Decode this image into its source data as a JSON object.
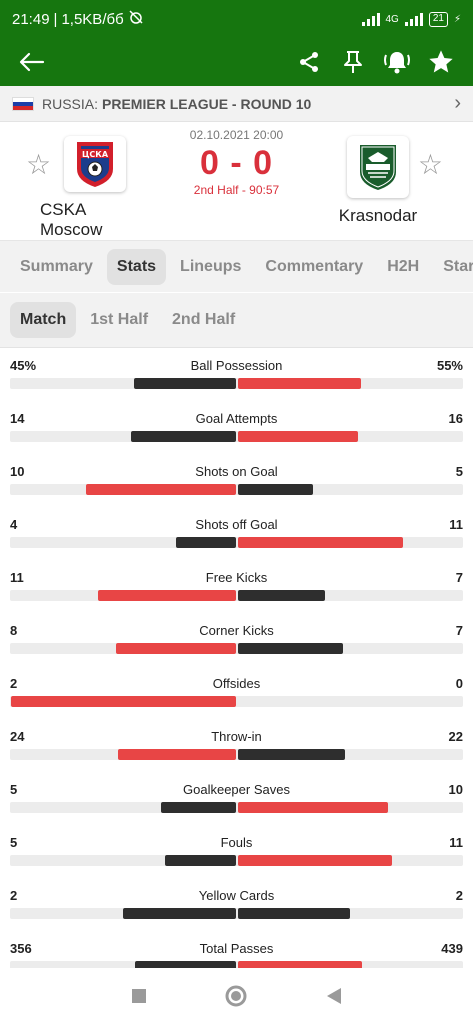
{
  "status_bar": {
    "time": "21:49",
    "speed": "1,5KB/бб",
    "net": "4G",
    "battery": "21"
  },
  "league": {
    "country": "RUSSIA:",
    "name": "PREMIER LEAGUE - ROUND 10"
  },
  "match": {
    "date": "02.10.2021 20:00",
    "score": "0 - 0",
    "status": "2nd Half - 90:57",
    "home": {
      "name": "CSKA Moscow",
      "logo_text": "ЦСКА"
    },
    "away": {
      "name": "Krasnodar"
    }
  },
  "tabs": [
    {
      "label": "Summary",
      "active": false
    },
    {
      "label": "Stats",
      "active": true
    },
    {
      "label": "Lineups",
      "active": false
    },
    {
      "label": "Commentary",
      "active": false
    },
    {
      "label": "H2H",
      "active": false
    },
    {
      "label": "Star",
      "active": false
    }
  ],
  "subtabs": [
    {
      "label": "Match",
      "active": true
    },
    {
      "label": "1st Half",
      "active": false
    },
    {
      "label": "2nd Half",
      "active": false
    }
  ],
  "colors": {
    "green": "#16760f",
    "red": "#e84545",
    "dark": "#2e2e2e",
    "track": "#ececec"
  },
  "stats": [
    {
      "name": "Ball Possession",
      "home": "45%",
      "away": "55%",
      "hv": 45,
      "av": 55
    },
    {
      "name": "Goal Attempts",
      "home": "14",
      "away": "16",
      "hv": 14,
      "av": 16
    },
    {
      "name": "Shots on Goal",
      "home": "10",
      "away": "5",
      "hv": 10,
      "av": 5
    },
    {
      "name": "Shots off Goal",
      "home": "4",
      "away": "11",
      "hv": 4,
      "av": 11
    },
    {
      "name": "Free Kicks",
      "home": "11",
      "away": "7",
      "hv": 11,
      "av": 7
    },
    {
      "name": "Corner Kicks",
      "home": "8",
      "away": "7",
      "hv": 8,
      "av": 7
    },
    {
      "name": "Offsides",
      "home": "2",
      "away": "0",
      "hv": 2,
      "av": 0
    },
    {
      "name": "Throw-in",
      "home": "24",
      "away": "22",
      "hv": 24,
      "av": 22
    },
    {
      "name": "Goalkeeper Saves",
      "home": "5",
      "away": "10",
      "hv": 5,
      "av": 10
    },
    {
      "name": "Fouls",
      "home": "5",
      "away": "11",
      "hv": 5,
      "av": 11
    },
    {
      "name": "Yellow Cards",
      "home": "2",
      "away": "2",
      "hv": 2,
      "av": 2
    },
    {
      "name": "Total Passes",
      "home": "356",
      "away": "439",
      "hv": 356,
      "av": 439
    }
  ]
}
